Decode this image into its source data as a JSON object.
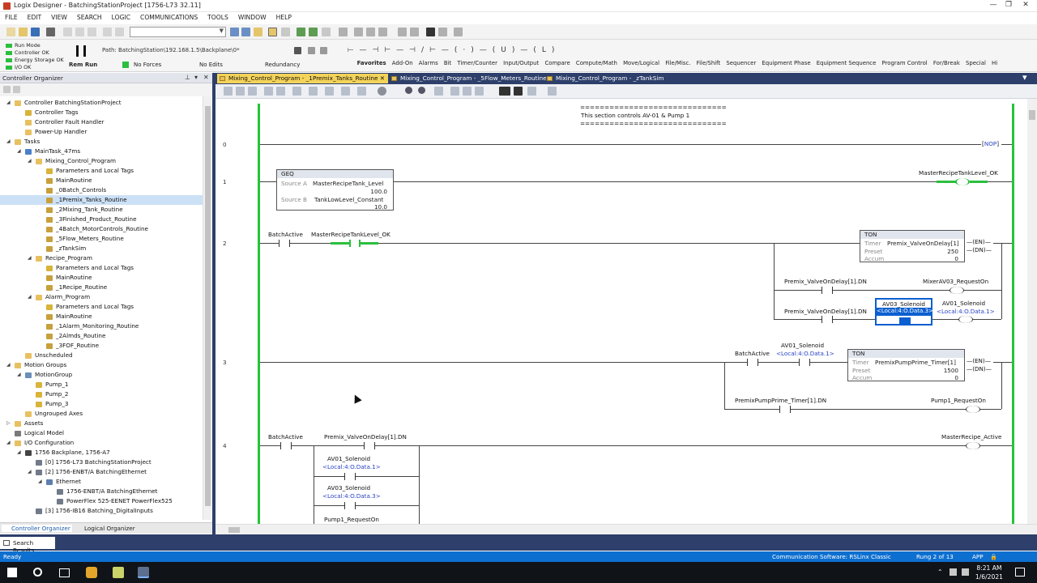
{
  "window": {
    "title": "Logix Designer - BatchingStationProject [1756-L73 32.11]",
    "controls": [
      "—",
      "❐",
      "✕"
    ]
  },
  "menu": [
    "FILE",
    "EDIT",
    "VIEW",
    "SEARCH",
    "LOGIC",
    "COMMUNICATIONS",
    "TOOLS",
    "WINDOW",
    "HELP"
  ],
  "controller_status": {
    "items": [
      {
        "label": "Run Mode",
        "color": "#2bbf3d"
      },
      {
        "label": "Controller OK",
        "color": "#2bbf3d"
      },
      {
        "label": "Energy Storage OK",
        "color": "#2bbf3d"
      },
      {
        "label": "I/O OK",
        "color": "#2bbf3d"
      }
    ],
    "mode": "Rem Run",
    "forces": "No Forces",
    "edits": "No Edits",
    "redundancy": "Redundancy"
  },
  "path": {
    "label": "Path:",
    "value": "BatchingStation\\192.168.1.5\\Backplane\\0*"
  },
  "instruction_tabs": [
    "Favorites",
    "Add-On",
    "Alarms",
    "Bit",
    "Timer/Counter",
    "Input/Output",
    "Compare",
    "Compute/Math",
    "Move/Logical",
    "File/Misc.",
    "File/Shift",
    "Sequencer",
    "Equipment Phase",
    "Equipment Sequence",
    "Program Control",
    "For/Break",
    "Special",
    "Hi"
  ],
  "organizer": {
    "title": "Controller Organizer",
    "tabs": [
      "Controller Organizer",
      "Logical Organizer"
    ],
    "tree": [
      {
        "label": "Controller BatchingStationProject",
        "level": 0,
        "exp": "◢",
        "icon": "folder"
      },
      {
        "label": "Controller Tags",
        "level": 1,
        "icon": "tag"
      },
      {
        "label": "Controller Fault Handler",
        "level": 1,
        "icon": "folder"
      },
      {
        "label": "Power-Up Handler",
        "level": 1,
        "icon": "folder"
      },
      {
        "label": "Tasks",
        "level": 0,
        "exp": "◢",
        "icon": "folder"
      },
      {
        "label": "MainTask_47ms",
        "level": 1,
        "exp": "◢",
        "icon": "task"
      },
      {
        "label": "Mixing_Control_Program",
        "level": 2,
        "exp": "◢",
        "icon": "folder"
      },
      {
        "label": "Parameters and Local Tags",
        "level": 3,
        "icon": "tag"
      },
      {
        "label": "MainRoutine",
        "level": 3,
        "icon": "routine"
      },
      {
        "label": "_0Batch_Controls",
        "level": 3,
        "icon": "routine"
      },
      {
        "label": "_1Premix_Tanks_Routine",
        "level": 3,
        "icon": "routine",
        "selected": true
      },
      {
        "label": "_2Mixing_Tank_Routine",
        "level": 3,
        "icon": "routine"
      },
      {
        "label": "_3Finished_Product_Routine",
        "level": 3,
        "icon": "routine"
      },
      {
        "label": "_4Batch_MotorControls_Routine",
        "level": 3,
        "icon": "routine"
      },
      {
        "label": "_5Flow_Meters_Routine",
        "level": 3,
        "icon": "routine"
      },
      {
        "label": "_zTankSim",
        "level": 3,
        "icon": "routine"
      },
      {
        "label": "Recipe_Program",
        "level": 2,
        "exp": "◢",
        "icon": "folder"
      },
      {
        "label": "Parameters and Local Tags",
        "level": 3,
        "icon": "tag"
      },
      {
        "label": "MainRoutine",
        "level": 3,
        "icon": "routine"
      },
      {
        "label": "_1Recipe_Routine",
        "level": 3,
        "icon": "routine"
      },
      {
        "label": "Alarm_Program",
        "level": 2,
        "exp": "◢",
        "icon": "folder"
      },
      {
        "label": "Parameters and Local Tags",
        "level": 3,
        "icon": "tag"
      },
      {
        "label": "MainRoutine",
        "level": 3,
        "icon": "routine"
      },
      {
        "label": "_1Alarm_Monitoring_Routine",
        "level": 3,
        "icon": "routine"
      },
      {
        "label": "_2Almds_Routine",
        "level": 3,
        "icon": "routine"
      },
      {
        "label": "_3FOF_Routine",
        "level": 3,
        "icon": "routine"
      },
      {
        "label": "Unscheduled",
        "level": 1,
        "icon": "folder"
      },
      {
        "label": "Motion Groups",
        "level": 0,
        "exp": "◢",
        "icon": "folder"
      },
      {
        "label": "MotionGroup",
        "level": 1,
        "exp": "◢",
        "icon": "motion"
      },
      {
        "label": "Pump_1",
        "level": 2,
        "icon": "tag"
      },
      {
        "label": "Pump_2",
        "level": 2,
        "icon": "tag"
      },
      {
        "label": "Pump_3",
        "level": 2,
        "icon": "tag"
      },
      {
        "label": "Ungrouped Axes",
        "level": 1,
        "icon": "folder"
      },
      {
        "label": "Assets",
        "level": 0,
        "exp": "▷",
        "icon": "folder"
      },
      {
        "label": "Logical Model",
        "level": 0,
        "icon": "model"
      },
      {
        "label": "I/O Configuration",
        "level": 0,
        "exp": "◢",
        "icon": "folder"
      },
      {
        "label": "1756 Backplane, 1756-A7",
        "level": 1,
        "exp": "◢",
        "icon": "rack"
      },
      {
        "label": "[0] 1756-L73 BatchingStationProject",
        "level": 2,
        "icon": "module"
      },
      {
        "label": "[2] 1756-ENBT/A BatchingEthernet",
        "level": 2,
        "exp": "◢",
        "icon": "module"
      },
      {
        "label": "Ethernet",
        "level": 3,
        "exp": "◢",
        "icon": "net"
      },
      {
        "label": "1756-ENBT/A BatchingEthernet",
        "level": 4,
        "icon": "module"
      },
      {
        "label": "PowerFlex 525-EENET PowerFlex525",
        "level": 4,
        "icon": "module"
      },
      {
        "label": "[3] 1756-IB16 Batching_DigitalInputs",
        "level": 2,
        "icon": "module"
      }
    ]
  },
  "doc_tabs": [
    {
      "label": "Mixing_Control_Program - _1Premix_Tanks_Routine",
      "active": true,
      "close": "✕"
    },
    {
      "label": "Mixing_Control_Program - _5Flow_Meters_Routine",
      "active": false
    },
    {
      "label": "Mixing_Control_Program - _zTankSim",
      "active": false
    }
  ],
  "ladder": {
    "comment": [
      "==============================",
      "This section controls AV-01 & Pump 1",
      "=============================="
    ],
    "rung_numbers": [
      "0",
      "1",
      "2",
      "3",
      "4"
    ],
    "r0": {
      "nop": "NOP"
    },
    "r1": {
      "geq": {
        "name": "GEQ",
        "srcA_label": "Source A",
        "srcA_tag": "MasterRecipeTank_Level",
        "srcA_val": "100.0",
        "srcB_label": "Source B",
        "srcB_tag": "TankLowLevel_Constant",
        "srcB_val": "10.0"
      },
      "coil": "MasterRecipeTankLevel_OK"
    },
    "r2": {
      "c1": "BatchActive",
      "c2": "MasterRecipeTankLevel_OK",
      "ton": {
        "name": "TON",
        "timer_label": "Timer",
        "timer_tag": "Premix_ValveOnDelay[1]",
        "preset_label": "Preset",
        "preset": "250",
        "accum_label": "Accum",
        "accum": "0",
        "en": "EN",
        "dn": "DN"
      },
      "b1_contact": "Premix_ValveOnDelay[1].DN",
      "b1_coil": "MixerAV03_RequestOn",
      "b2_contact": "Premix_ValveOnDelay[1].DN",
      "b2_sel": "AV03_Solenoid",
      "b2_sel_sub": "<Local:4:O.Data.3>",
      "b2_coil": "AV01_Solenoid",
      "b2_coil_sub": "<Local:4:O.Data.1>"
    },
    "r3": {
      "c1": "BatchActive",
      "c2": "AV01_Solenoid",
      "c2_sub": "<Local:4:O.Data.1>",
      "ton": {
        "name": "TON",
        "timer_label": "Timer",
        "timer_tag": "PremixPumpPrime_Timer[1]",
        "preset_label": "Preset",
        "preset": "1500",
        "accum_label": "Accum",
        "accum": "0",
        "en": "EN",
        "dn": "DN"
      },
      "b1_contact": "PremixPumpPrime_Timer[1].DN",
      "b1_coil": "Pump1_RequestOn"
    },
    "r4": {
      "c1": "BatchActive",
      "c2": "Premix_ValveOnDelay[1].DN",
      "p1": "AV01_Solenoid",
      "p1_sub": "<Local:4:O.Data.1>",
      "p2": "AV03_Solenoid",
      "p2_sub": "<Local:4:O.Data.3>",
      "p3": "Pump1_RequestOn",
      "coil": "MasterRecipe_Active"
    }
  },
  "search_results": "Search Results",
  "status": {
    "left": "Ready",
    "comm": "Communication Software: RSLinx Classic",
    "rung": "Rung 2 of 13",
    "app": "APP"
  },
  "taskbar": {
    "time": "8:21 AM",
    "date": "1/6/2021"
  }
}
